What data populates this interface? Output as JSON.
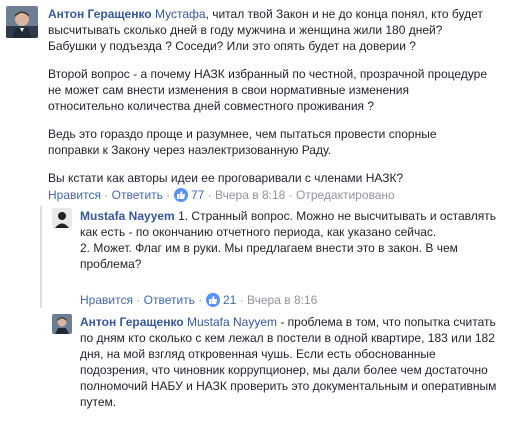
{
  "comments": [
    {
      "author": "Антон Геращенко",
      "text_lead_mention": "Мустафа",
      "paragraphs": [
        ", читал твой Закон и не до конца понял, кто будет высчитывать сколько дней в году мужчина и женщина жили 180 дней? Бабушки у подъезда ? Соседи? Или это опять будет на доверии ?",
        "Второй вопрос - а почему НАЗК избранный по честной, прозрачной процедуре не может сам внести изменения в свои нормативные изменения относительно количества дней совместного проживания ?",
        "Ведь это гораздо проще и разумнее, чем пытаться провести спорные поправки к Закону через наэлектризованную Раду.",
        "Вы кстати как авторы идеи ее проговаривали с членами НАЗК?"
      ],
      "like_label": "Нравится",
      "reply_label": "Ответить",
      "likes": "77",
      "time": "Вчера в 8:18",
      "edited": "Отредактировано",
      "avatar_colors": [
        "#3b4a5c",
        "#d9b59c",
        "#2f3b4a"
      ]
    },
    {
      "author": "Mustafa Nayyem",
      "paragraphs": [
        "1. Странный вопрос. Можно не высчитывать и оставлять как есть - по окончанию отчетного периода, как указано сейчас.",
        "2. Может. Флаг им в руки. Мы предлагаем внести это в закон. В чем проблема?"
      ],
      "like_label": "Нравится",
      "reply_label": "Ответить",
      "likes": "21",
      "time": "Вчера в 8:16",
      "avatar_colors": [
        "#e9e9e9",
        "#222222"
      ]
    },
    {
      "author": "Антон Геращенко",
      "mention": "Mustafa Nayyem",
      "text": " - проблема в том, что попытка считать по дням кто сколько с кем лежал в постели в одной квартире, 183 или 182 дня, на мой взгляд откровенная чушь. Если есть обоснованные подозрения, что чиновник коррупционер, мы дали более чем достаточно полномочий НАБУ и НАЗК проверить это документальным и оперативным путем.",
      "avatar_colors": [
        "#3b4a5c",
        "#d9b59c",
        "#2f3b4a"
      ]
    }
  ],
  "icons": {
    "like_badge": "thumbs-up-icon"
  },
  "colors": {
    "link": "#365899",
    "meta": "#90949c",
    "action": "#4267b2",
    "like_badge": "#5890ff"
  }
}
